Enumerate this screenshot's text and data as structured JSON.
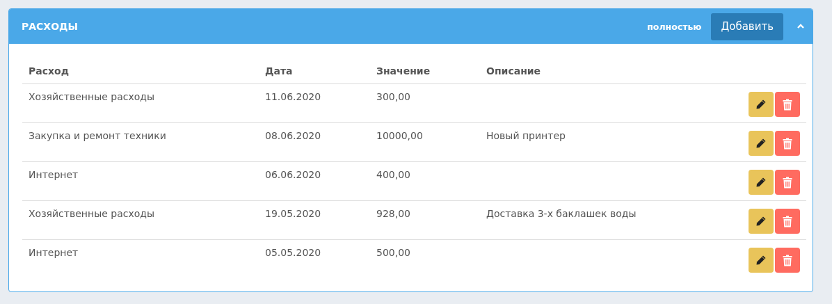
{
  "panel": {
    "title": "РАСХОДЫ",
    "link": "полностью",
    "add_button": "Добавить",
    "expanded": true
  },
  "table": {
    "columns": [
      "Расход",
      "Дата",
      "Значение",
      "Описание"
    ],
    "rows": [
      {
        "expense": "Хозяйственные расходы",
        "date": "11.06.2020",
        "value": "300,00",
        "description": ""
      },
      {
        "expense": "Закупка и ремонт техники",
        "date": "08.06.2020",
        "value": "10000,00",
        "description": "Новый принтер"
      },
      {
        "expense": "Интернет",
        "date": "06.06.2020",
        "value": "400,00",
        "description": ""
      },
      {
        "expense": "Хозяйственные расходы",
        "date": "19.05.2020",
        "value": "928,00",
        "description": "Доставка 3-х баклашек воды"
      },
      {
        "expense": "Интернет",
        "date": "05.05.2020",
        "value": "500,00",
        "description": ""
      }
    ]
  }
}
